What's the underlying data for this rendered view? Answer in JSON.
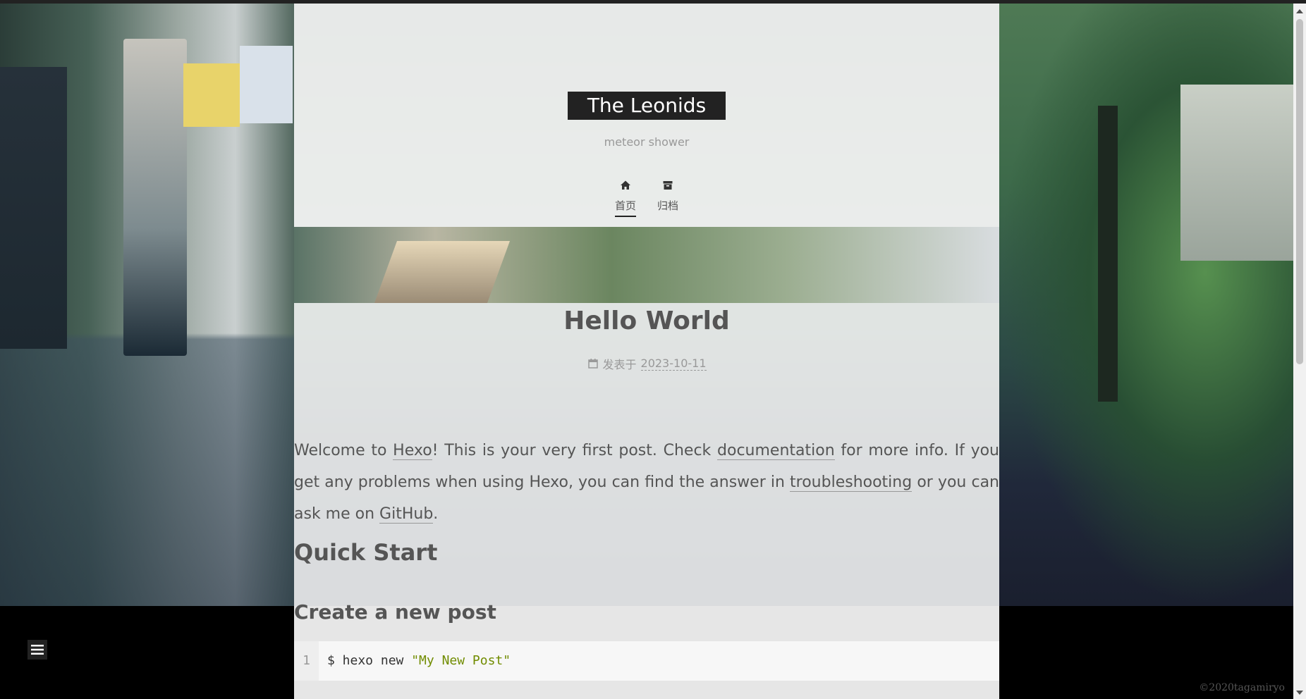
{
  "site": {
    "title": "The Leonids",
    "subtitle": "meteor shower"
  },
  "nav": [
    {
      "label": "首页",
      "icon": "home-icon",
      "active": true
    },
    {
      "label": "归档",
      "icon": "archive-icon",
      "active": false
    }
  ],
  "post": {
    "title": "Hello World",
    "meta_prefix": "发表于",
    "date": "2023-10-11",
    "intro": {
      "t1": "Welcome to ",
      "link_hexo": "Hexo",
      "t2": "! This is your very first post. Check ",
      "link_docs": "documentation",
      "t3": " for more info. If you get any problems when using Hexo, you can find the answer in ",
      "link_trouble": "troubleshooting",
      "t4": " or you can ask me on ",
      "link_github": "GitHub",
      "t5": "."
    },
    "h_quick_start": "Quick Start",
    "h_create_post": "Create a new post",
    "code": {
      "line_no": "1",
      "prefix": "$ hexo new ",
      "string": "\"My New Post\""
    }
  },
  "footer": {
    "copyright": "©2020tagamiryo"
  },
  "colors": {
    "brand_bg": "#222222",
    "code_string": "#718c00"
  }
}
